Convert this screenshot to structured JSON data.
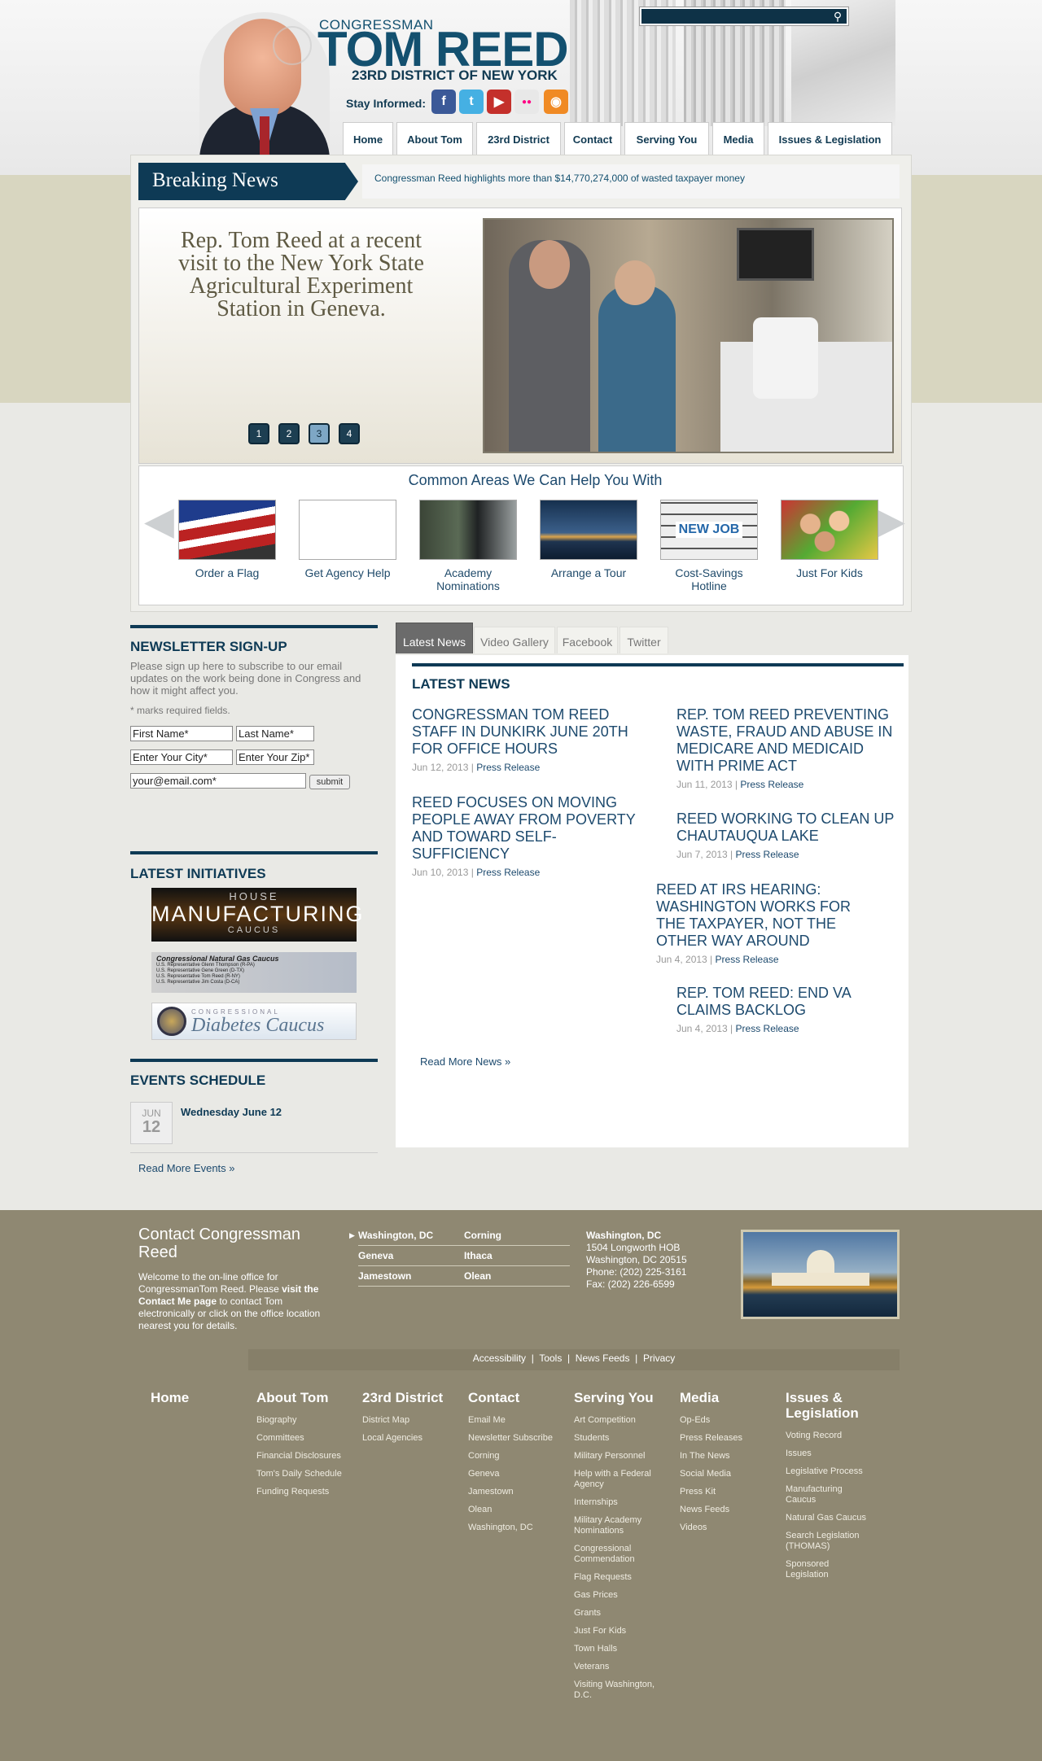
{
  "header": {
    "pre_title": "CONGRESSMAN",
    "title": "TOM REED",
    "district": "23RD DISTRICT OF NEW YORK",
    "stay_informed": "Stay Informed:"
  },
  "social": [
    {
      "name": "facebook-icon",
      "glyph": "f",
      "color": "#3b5998"
    },
    {
      "name": "twitter-icon",
      "glyph": "t",
      "color": "#45b0e3"
    },
    {
      "name": "youtube-icon",
      "glyph": "▶",
      "color": "#c4302b"
    },
    {
      "name": "flickr-icon",
      "glyph": "●●",
      "color": "#e8e8e8"
    },
    {
      "name": "rss-icon",
      "glyph": "◉",
      "color": "#f08a24"
    }
  ],
  "nav": [
    "Home",
    "About Tom",
    "23rd District",
    "Contact",
    "Serving You",
    "Media",
    "Issues & Legislation"
  ],
  "breaking": {
    "label": "Breaking News",
    "text": "Congressman Reed highlights more than $14,770,274,000 of wasted taxpayer money"
  },
  "slider": {
    "caption": "Rep. Tom Reed at a recent visit to the New York State Agricultural Experiment Station in Geneva.",
    "pages": [
      "1",
      "2",
      "3",
      "4"
    ],
    "active_page": 3
  },
  "help": {
    "title": "Common Areas We Can Help You With",
    "items": [
      "Order a Flag",
      "Get Agency Help",
      "Academy Nominations",
      "Arrange a Tour",
      "Cost-Savings Hotline",
      "Just For Kids"
    ]
  },
  "newsletter": {
    "title": "NEWSLETTER SIGN-UP",
    "desc": "Please sign up here to subscribe to our email updates on the work being done in Congress and how it might affect you.",
    "required": "* marks required fields.",
    "first_name": "First Name*",
    "last_name": "Last Name*",
    "city": "Enter Your City*",
    "zip": "Enter Your Zip*",
    "email": "your@email.com*",
    "submit": "submit"
  },
  "initiatives": {
    "title": "LATEST INITIATIVES",
    "items": [
      {
        "top": "HOUSE",
        "main": "MANUFACTURING",
        "sub": "CAUCUS"
      },
      {
        "top": "Congressional Natural Gas Caucus",
        "lines": [
          "U.S. Representative Glenn Thompson (R-PA)",
          "U.S. Representative Gene Green (D-TX)",
          "U.S. Representative Tom Reed (R-NY)",
          "U.S. Representative Jim Costa (D-CA)"
        ]
      },
      {
        "top": "CONGRESSIONAL",
        "main": "Diabetes Caucus"
      }
    ]
  },
  "events": {
    "title": "EVENTS SCHEDULE",
    "month": "JUN",
    "day": "12",
    "date_label": "Wednesday June 12",
    "more": "Read More Events »"
  },
  "tabs": [
    "Latest News",
    "Video Gallery",
    "Facebook",
    "Twitter"
  ],
  "news": {
    "heading": "LATEST NEWS",
    "items": [
      {
        "title": "CONGRESSMAN TOM REED STAFF IN DUNKIRK JUNE 20TH FOR OFFICE HOURS",
        "date": "Jun 12, 2013",
        "cat": "Press Release"
      },
      {
        "title": "REP. TOM REED PREVENTING WASTE, FRAUD AND ABUSE IN MEDICARE AND MEDICAID WITH PRIME ACT",
        "date": "Jun 11, 2013",
        "cat": "Press Release"
      },
      {
        "title": "REED FOCUSES ON MOVING PEOPLE AWAY FROM POVERTY AND TOWARD SELF-SUFFICIENCY",
        "date": "Jun 10, 2013",
        "cat": "Press Release"
      },
      {
        "title": "REED WORKING TO CLEAN UP CHAUTAUQUA LAKE",
        "date": "Jun 7, 2013",
        "cat": "Press Release"
      },
      {
        "title": "REED AT IRS HEARING: WASHINGTON WORKS FOR THE TAXPAYER, NOT THE OTHER WAY AROUND",
        "date": "Jun 4, 2013",
        "cat": "Press Release"
      },
      {
        "title": "REP. TOM REED: END VA CLAIMS BACKLOG",
        "date": "Jun 4, 2013",
        "cat": "Press Release"
      }
    ],
    "more": "Read More News »"
  },
  "footer": {
    "contact_title": "Contact Congressman Reed",
    "welcome_a": "Welcome to the on-line office for CongressmanTom Reed. Please ",
    "welcome_link": "visit the Contact Me page",
    "welcome_b": " to contact Tom electronically or click on the office location nearest you for details.",
    "offices": [
      "Washington, DC",
      "Corning",
      "Geneva",
      "Ithaca",
      "Jamestown",
      "Olean"
    ],
    "address": {
      "name": "Washington, DC",
      "line1": "1504 Longworth HOB",
      "line2": "Washington, DC 20515",
      "phone": "Phone: (202) 225-3161",
      "fax": "Fax: (202) 226-6599"
    },
    "util": [
      "Accessibility",
      "Tools",
      "News Feeds",
      "Privacy"
    ],
    "cols": [
      {
        "head": "Home",
        "links": []
      },
      {
        "head": "About Tom",
        "links": [
          "Biography",
          "Committees",
          "Financial Disclosures",
          "Tom's Daily Schedule",
          "Funding Requests"
        ]
      },
      {
        "head": "23rd District",
        "links": [
          "District Map",
          "Local Agencies"
        ]
      },
      {
        "head": "Contact",
        "links": [
          "Email Me",
          "Newsletter Subscribe",
          "Corning",
          "Geneva",
          "Jamestown",
          "Olean",
          "Washington, DC"
        ]
      },
      {
        "head": "Serving You",
        "links": [
          "Art Competition",
          "Students",
          "Military Personnel",
          "Help with a Federal Agency",
          "Internships",
          "Military Academy Nominations",
          "Congressional Commendation",
          "Flag Requests",
          "Gas Prices",
          "Grants",
          "Just For Kids",
          "Town Halls",
          "Veterans",
          "Visiting Washington, D.C."
        ]
      },
      {
        "head": "Media",
        "links": [
          "Op-Eds",
          "Press Releases",
          "In The News",
          "Social Media",
          "Press Kit",
          "News Feeds",
          "Videos"
        ]
      },
      {
        "head": "Issues & Legislation",
        "links": [
          "Voting Record",
          "Issues",
          "Legislative Process",
          "Manufacturing Caucus",
          "Natural Gas Caucus",
          "Search Legislation (THOMAS)",
          "Sponsored Legislation"
        ]
      }
    ]
  }
}
